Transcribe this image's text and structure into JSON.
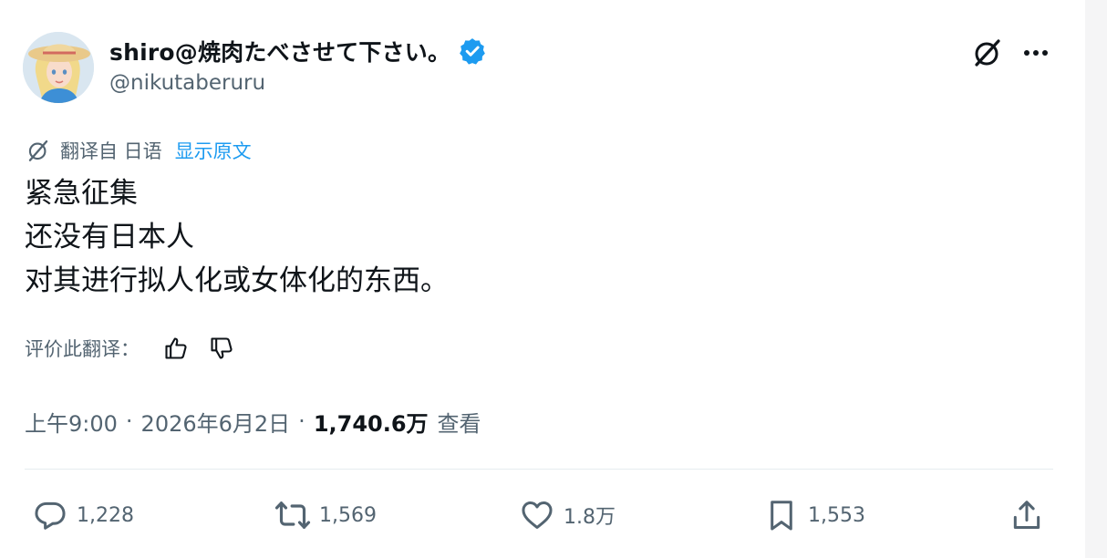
{
  "user": {
    "display_name": "shiro@焼肉たべさせて下さい。",
    "handle": "@nikutaberuru",
    "avatar_icon": "avatar-portrait",
    "verified_icon": "verified-badge-icon",
    "verified_color": "#1d9bf0"
  },
  "header_actions": {
    "grok_icon": "grok-icon",
    "more_icon": "more-icon"
  },
  "translation": {
    "icon": "translate-icon",
    "label": "翻译自 日语",
    "show_original": "显示原文",
    "link_color": "#1d9bf0"
  },
  "tweet": {
    "lines": [
      "紧急征集",
      "还没有日本人",
      "对其进行拟人化或女体化的东西。"
    ]
  },
  "rate_translation": {
    "label": "评价此翻译：",
    "thumbs_up_icon": "thumbs-up-icon",
    "thumbs_down_icon": "thumbs-down-icon"
  },
  "meta": {
    "time": "上午9:00",
    "separator": "·",
    "date": "2026年6月2日",
    "views_count": "1,740.6万",
    "views_label": "查看"
  },
  "actions": {
    "reply": {
      "icon": "reply-icon",
      "count": "1,228"
    },
    "retweet": {
      "icon": "retweet-icon",
      "count": "1,569"
    },
    "like": {
      "icon": "heart-icon",
      "count": "1.8万"
    },
    "bookmark": {
      "icon": "bookmark-icon",
      "count": "1,553"
    },
    "share": {
      "icon": "share-icon"
    }
  }
}
